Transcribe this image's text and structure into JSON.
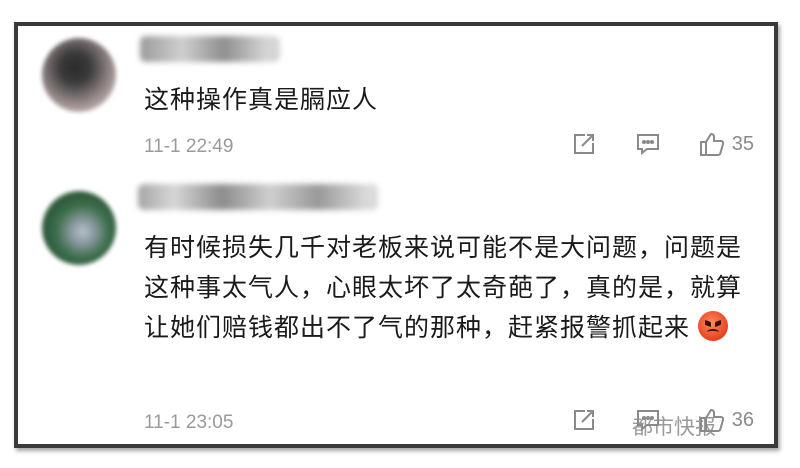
{
  "comments": [
    {
      "text": "这种操作真是膈应人",
      "time": "11-1 22:49",
      "likes": "35"
    },
    {
      "text": "有时候损失几千对老板来说可能不是大问题，问题是这种事太气人，心眼太坏了太奇葩了，真的是，就算让她们赔钱都出不了气的那种，赶紧报警抓起来",
      "time": "11-1 23:05",
      "likes": "36",
      "emoji": "angry-face-icon"
    }
  ],
  "watermark": "都市快报",
  "icons": [
    "share-icon",
    "comment-icon",
    "thumbs-up-icon"
  ],
  "colors": {
    "text": "#1a1a1a",
    "meta": "#9a9a9a",
    "frame": "#3a3a3a"
  }
}
